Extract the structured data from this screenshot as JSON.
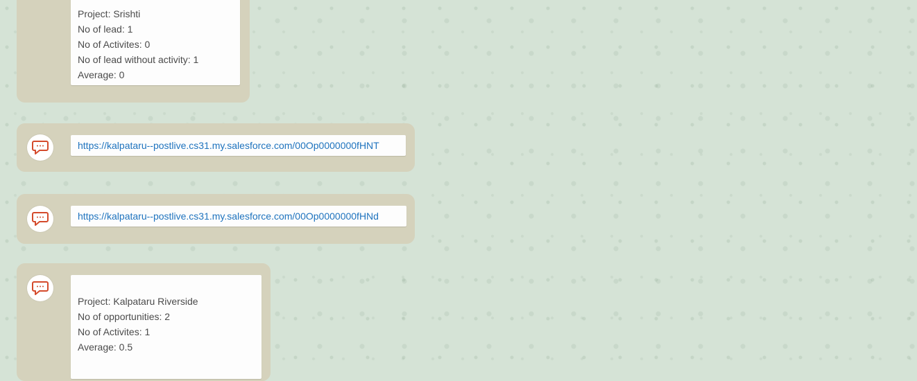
{
  "messages": [
    {
      "lines": [
        "Project: Srishti",
        "No of lead: 1",
        "No of Activites: 0",
        "No of lead without activity: 1",
        "Average: 0"
      ]
    },
    {
      "link": "https://kalpataru--postlive.cs31.my.salesforce.com/00Op0000000fHNT"
    },
    {
      "link": "https://kalpataru--postlive.cs31.my.salesforce.com/00Op0000000fHNd"
    },
    {
      "lines": [
        "Project: Kalpataru Riverside",
        "No of opportunities: 2",
        "No of Activites: 1",
        "Average: 0.5"
      ]
    }
  ],
  "icons": {
    "avatar": "chat-bubble-icon"
  },
  "colors": {
    "background": "#d5e3d6",
    "row": "#d9d8c6",
    "bubble": "#fdfdfd",
    "link": "#1e73be",
    "avatar_icon": "#d44a2b"
  }
}
